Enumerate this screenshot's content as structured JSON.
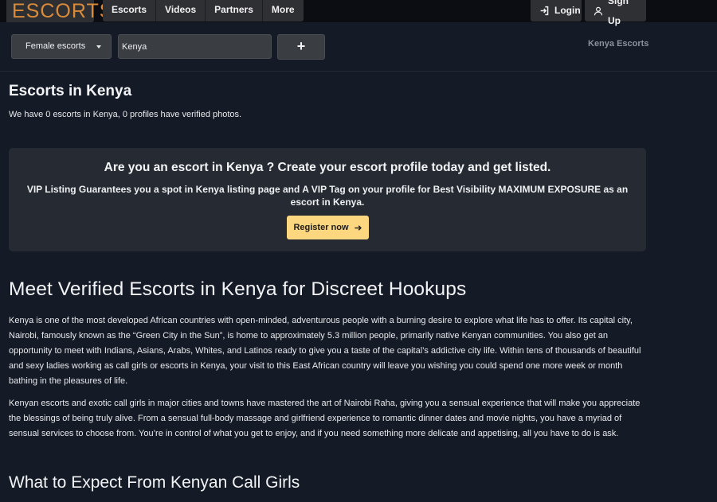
{
  "navbar": {
    "logo": "ESCORTS",
    "tabs": [
      "Escorts",
      "Videos",
      "Partners",
      "More"
    ],
    "login": "Login",
    "signup": "Sign Up"
  },
  "filters": {
    "category": "Female escorts",
    "location_value": "Kenya",
    "add_label": "+"
  },
  "breadcrumb": "Kenya Escorts",
  "page": {
    "title": "Escorts in Kenya",
    "subtitle": "We have 0 escorts in Kenya, 0 profiles have verified photos."
  },
  "promo": {
    "title": "Are you an escort in Kenya ? Create your escort profile today and get listed.",
    "body": "VIP Listing Guarantees you a spot in Kenya listing page and A VIP Tag on your profile for Best Visibility MAXIMUM EXPOSURE as an escort in Kenya.",
    "button": "Register now"
  },
  "article": {
    "heading": "Meet Verified Escorts in Kenya for Discreet Hookups",
    "paragraphs": [
      "Kenya is one of the most developed African countries with open-minded, adventurous people with a burning desire to explore what life has to offer. Its capital city, Nairobi, famously known as the “Green City in the Sun”, is home to approximately 5.3 million people, primarily native Kenyan communities. You also get an opportunity to meet with Indians, Asians, Arabs, Whites, and Latinos ready to give you a taste of the capital’s addictive city life. Within tens of thousands of beautiful and sexy ladies working as call girls or escorts in Kenya, your visit to this East African country will leave you wishing you could spend one more week or month bathing in the pleasures of life.",
      "Kenyan escorts and exotic call girls in major cities and towns have mastered the art of Nairobi Raha, giving you a sensual experience that will make you appreciate the blessings of being truly alive. From a sensual full-body massage and girlfriend experience to romantic dinner dates and movie nights, you have a myriad of sensual services to choose from. You’re in control of what you get to enjoy, and if you need something more delicate and appetising, all you have to do is ask."
    ],
    "subheading": "What to Expect From Kenyan Call Girls"
  },
  "colors": {
    "background": "#141a26",
    "logo": "#d98b3a",
    "button_accent": "#fcd77f"
  },
  "icons": {
    "login": "login-arrow-icon",
    "signup": "user-icon",
    "register": "arrow-right-icon",
    "dropdown": "caret-down-icon"
  }
}
